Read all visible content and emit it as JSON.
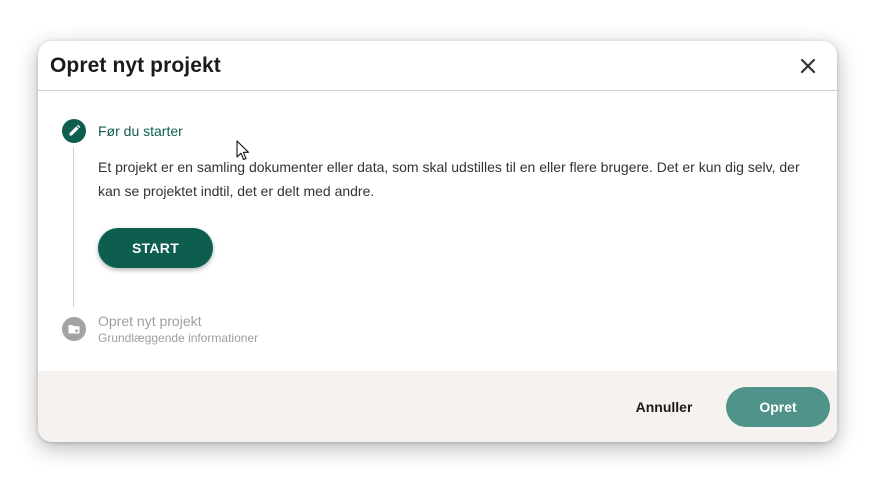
{
  "dialog": {
    "title": "Opret nyt projekt",
    "close_icon": "close-icon"
  },
  "steps": [
    {
      "title": "Før du starter",
      "icon": "pencil-icon",
      "state": "active",
      "description": "Et projekt er en samling dokumenter eller data, som skal udstilles til en eller flere brugere. Det er kun dig selv, der kan se projektet indtil, det er delt med andre.",
      "button_label": "START"
    },
    {
      "title": "Opret nyt projekt",
      "subtitle": "Grundlæggende informationer",
      "icon": "folder-add-icon",
      "state": "inactive"
    }
  ],
  "footer": {
    "cancel_label": "Annuller",
    "create_label": "Opret"
  },
  "colors": {
    "primary": "#0d5e4f",
    "primary_disabled": "#4f938a",
    "inactive": "#a3a3a3",
    "footer_bg": "#f5f2ef"
  }
}
